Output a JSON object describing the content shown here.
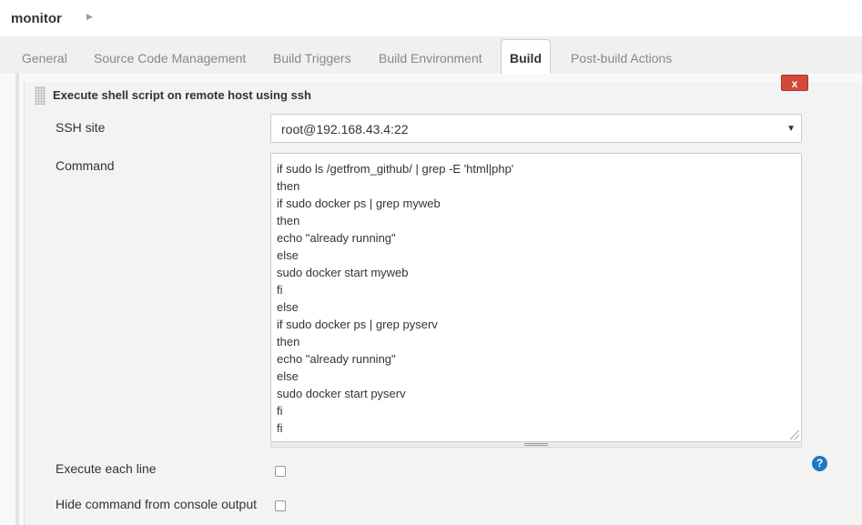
{
  "breadcrumb": {
    "job_name": "monitor",
    "arrow_icon": "chevron-right-icon"
  },
  "tabs": [
    {
      "label": "General"
    },
    {
      "label": "Source Code Management"
    },
    {
      "label": "Build Triggers"
    },
    {
      "label": "Build Environment"
    },
    {
      "label": "Build",
      "active": true
    },
    {
      "label": "Post-build Actions"
    }
  ],
  "section": {
    "title": "Execute shell script on remote host using ssh",
    "delete_label": "x",
    "drag_icon": "drag-handle-icon"
  },
  "ssh_site": {
    "label": "SSH site",
    "value": "root@192.168.43.4:22"
  },
  "command": {
    "label": "Command",
    "value": "if sudo ls /getfrom_github/ | grep -E 'html|php'\nthen\nif sudo docker ps | grep myweb\nthen\necho \"already running\"\nelse\nsudo docker start myweb\nfi\nelse\nif sudo docker ps | grep pyserv\nthen\necho \"already running\"\nelse\nsudo docker start pyserv\nfi\nfi"
  },
  "options": {
    "execute_each_line": {
      "label": "Execute each line",
      "checked": false
    },
    "hide_command": {
      "label": "Hide command from console output",
      "checked": false
    }
  },
  "help_icon": {
    "glyph": "?",
    "color": "#1d78c1"
  },
  "colors": {
    "delete": "#d24939",
    "help": "#1d78c1"
  }
}
